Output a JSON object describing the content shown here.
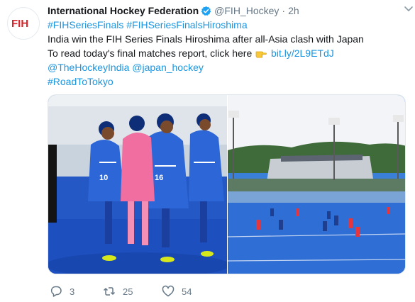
{
  "tweet": {
    "author_name": "International Hockey Federation",
    "handle": "@FIH_Hockey",
    "separator": "·",
    "time": "2h",
    "avatar_logo": "FIH",
    "hashtags_line": "#FIHSeriesFinals #FIHSeriesFinalsHiroshima",
    "line2": "India win the FIH Series Finals Hiroshima after all-Asia clash with Japan",
    "line3_prefix": "To read today's final matches report, click here",
    "line3_link": "bit.ly/2L9ETdJ",
    "mentions_line": "@TheHockeyIndia @japan_hockey",
    "tag_line": "#RoadToTokyo"
  },
  "media": {
    "left_photo": "India women's hockey team celebrating",
    "right_photo": "Hockey stadium match view"
  },
  "actions": {
    "reply_count": "3",
    "retweet_count": "25",
    "like_count": "54"
  },
  "icons": {
    "verified": "verified-badge-icon",
    "chevron": "chevron-down-icon",
    "pointing": "pointing-right-emoji-icon",
    "reply": "reply-icon",
    "retweet": "retweet-icon",
    "like": "heart-icon"
  },
  "colors": {
    "link": "#1b95e0",
    "muted": "#657786",
    "verified": "#1da1f2",
    "fih_red": "#d7262b",
    "fih_blue": "#1a3b8b"
  }
}
